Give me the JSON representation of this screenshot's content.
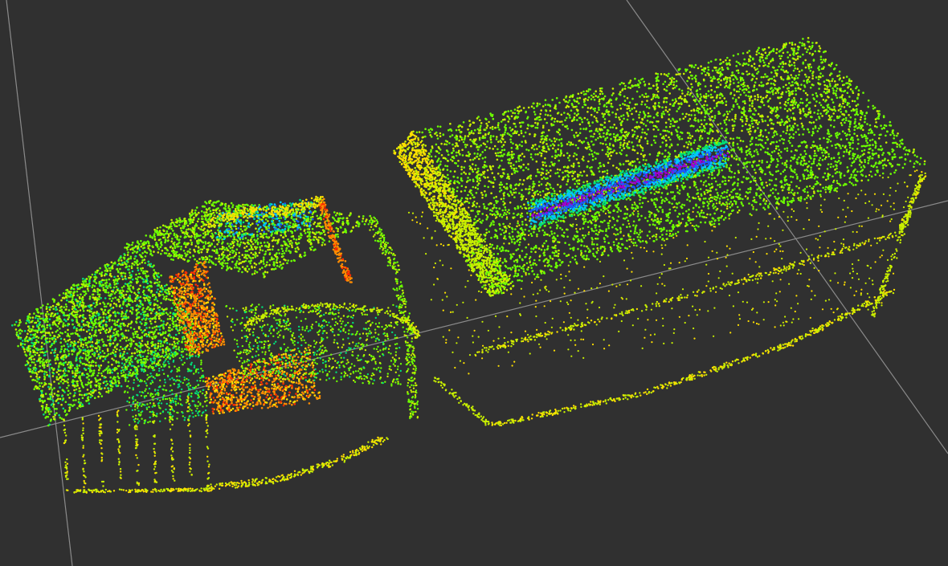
{
  "viewport": {
    "background_color": "#303030",
    "grid_color": "#8a8a8a"
  },
  "point_cloud": {
    "colormap": [
      "#ff2a00",
      "#ff8c00",
      "#ffe000",
      "#c8f000",
      "#6cff00",
      "#00e07a",
      "#00c8ff",
      "#1a5cff",
      "#a000d0"
    ],
    "objects": [
      {
        "name": "vehicle-cab",
        "dominant_color": "#7cf000"
      },
      {
        "name": "trailer-box",
        "dominant_color": "#a8f000"
      },
      {
        "name": "roof-depression",
        "dominant_color": "#1a3cff"
      }
    ]
  }
}
